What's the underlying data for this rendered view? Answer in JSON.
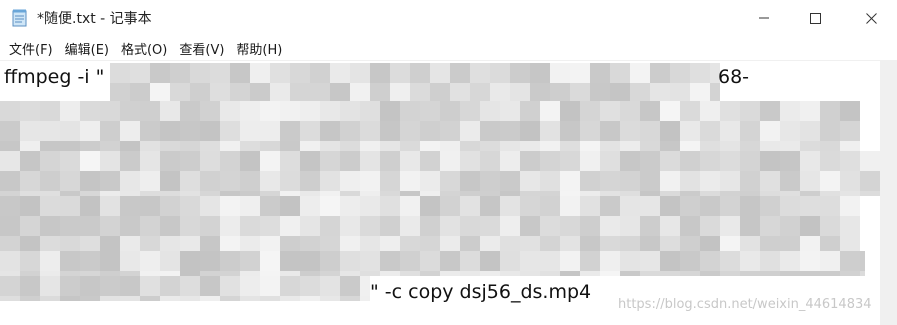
{
  "window": {
    "title": "*随便.txt - 记事本",
    "minimize_icon": "minimize-icon",
    "maximize_icon": "maximize-icon",
    "close_icon": "close-icon"
  },
  "menu": {
    "items": [
      {
        "label": "文件(F)"
      },
      {
        "label": "编辑(E)"
      },
      {
        "label": "格式(O)"
      },
      {
        "label": "查看(V)"
      },
      {
        "label": "帮助(H)"
      }
    ]
  },
  "editor": {
    "line1_visible": "ffmpeg -i \"",
    "line1_suffix": "68-",
    "last_line_visible": "\" -c copy dsj56_ds.mp4",
    "content_obscured": "pixelated mosaic"
  },
  "watermark": "https://blog.csdn.net/weixin_44614834",
  "colors": {
    "background": "#ffffff",
    "scrollbar": "#f0f0f0",
    "mosaic_light": "#e6e6e6",
    "mosaic_dark": "#bdbdbd"
  }
}
